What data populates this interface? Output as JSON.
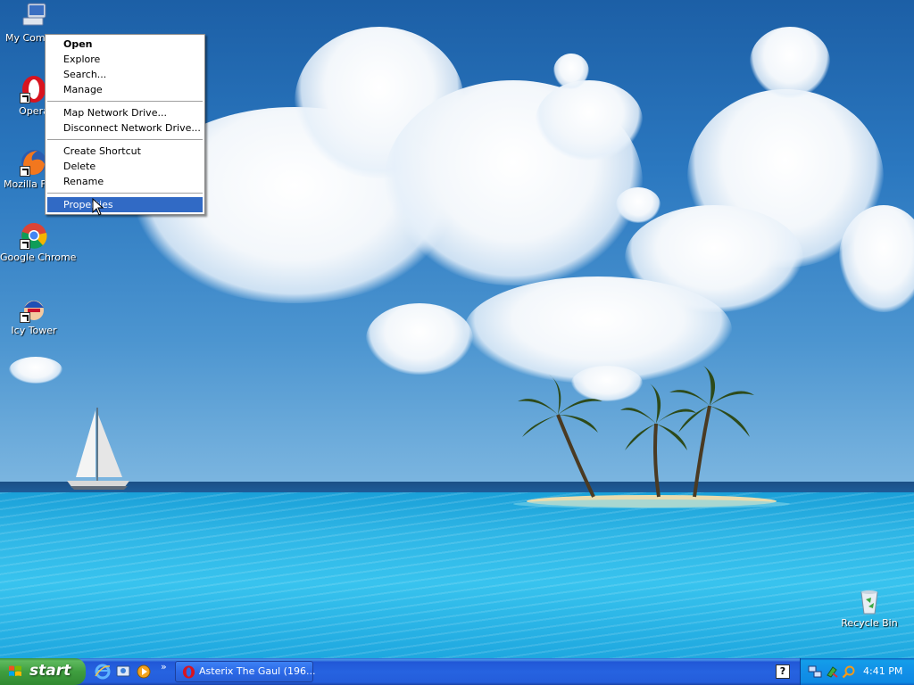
{
  "desktop": {
    "icons": [
      {
        "label": "My Comp",
        "name": "my-computer"
      },
      {
        "label": "Opera",
        "name": "opera"
      },
      {
        "label": "Mozilla Fir",
        "name": "mozilla-firefox"
      },
      {
        "label": "Google Chrome",
        "name": "google-chrome"
      },
      {
        "label": "Icy Tower",
        "name": "icy-tower"
      },
      {
        "label": "Recycle Bin",
        "name": "recycle-bin"
      }
    ]
  },
  "context_menu": {
    "items": [
      {
        "label": "Open"
      },
      {
        "label": "Explore"
      },
      {
        "label": "Search..."
      },
      {
        "label": "Manage"
      },
      {
        "label": "Map Network Drive..."
      },
      {
        "label": "Disconnect Network Drive..."
      },
      {
        "label": "Create Shortcut"
      },
      {
        "label": "Delete"
      },
      {
        "label": "Rename"
      },
      {
        "label": "Properties"
      }
    ],
    "highlighted": "Properties"
  },
  "taskbar": {
    "start_label": "start",
    "quick_launch": [
      "internet-explorer-icon",
      "show-desktop-icon",
      "media-player-icon"
    ],
    "chevron": "»",
    "tasks": [
      {
        "label": "Asterix The Gaul (196..."
      }
    ],
    "help_label": "?",
    "clock": "4:41 PM"
  },
  "colors": {
    "menu_highlight": "#316ac5",
    "taskbar_blue": "#245ddb",
    "start_green": "#3f9e3f"
  }
}
